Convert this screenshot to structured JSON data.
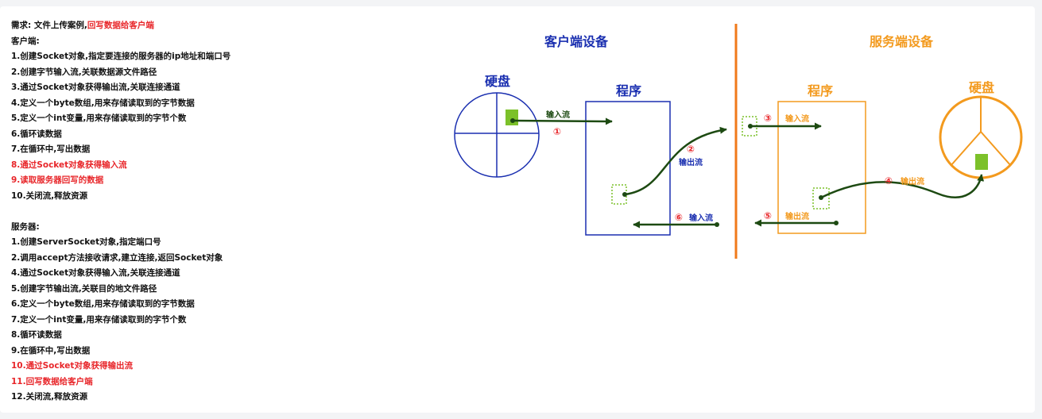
{
  "requirements": {
    "title": "需求: 文件上传案例,",
    "title_highlight": "回写数据给客户端",
    "client_heading": "客户端:",
    "client_steps": [
      {
        "text": "1.创建Socket对象,指定要连接的服务器的ip地址和端口号",
        "highlight": false
      },
      {
        "text": "2.创建字节输入流,关联数据源文件路径",
        "highlight": false
      },
      {
        "text": "3.通过Socket对象获得输出流,关联连接通道",
        "highlight": false
      },
      {
        "text": "4.定义一个byte数组,用来存储读取到的字节数据",
        "highlight": false
      },
      {
        "text": "5.定义一个int变量,用来存储读取到的字节个数",
        "highlight": false
      },
      {
        "text": "6.循环读数据",
        "highlight": false
      },
      {
        "text": "7.在循环中,写出数据",
        "highlight": false
      },
      {
        "text": "8.通过Socket对象获得输入流",
        "highlight": true
      },
      {
        "text": "9.读取服务器回写的数据",
        "highlight": true
      },
      {
        "text": "10.关闭流,释放资源",
        "highlight": false
      }
    ],
    "server_heading": "服务器:",
    "server_steps": [
      {
        "text": "1.创建ServerSocket对象,指定端口号",
        "highlight": false
      },
      {
        "text": "2.调用accept方法接收请求,建立连接,返回Socket对象",
        "highlight": false
      },
      {
        "text": "4.通过Socket对象获得输入流,关联连接通道",
        "highlight": false
      },
      {
        "text": "5.创建字节输出流,关联目的地文件路径",
        "highlight": false
      },
      {
        "text": "6.定义一个byte数组,用来存储读取到的字节数据",
        "highlight": false
      },
      {
        "text": "7.定义一个int变量,用来存储读取到的字节个数",
        "highlight": false
      },
      {
        "text": "8.循环读数据",
        "highlight": false
      },
      {
        "text": "9.在循环中,写出数据",
        "highlight": false
      },
      {
        "text": "10.通过Socket对象获得输出流",
        "highlight": true
      },
      {
        "text": "11.回写数据给客户端",
        "highlight": true
      },
      {
        "text": "12.关闭流,释放资源",
        "highlight": false
      }
    ]
  },
  "diagram": {
    "client_device": "客户端设备",
    "server_device": "服务端设备",
    "client_disk": "硬盘",
    "server_disk": "硬盘",
    "client_program": "程序",
    "server_program": "程序",
    "step1_label": "输入流",
    "step1_num": "①",
    "step2_num": "②",
    "step2_label": "输出流",
    "step3_num": "③",
    "step3_label": "输入流",
    "step4_num": "④",
    "step4_label": "输出流",
    "step5_num": "⑤",
    "step5_label": "输出流",
    "step6_num": "⑥",
    "step6_label": "输入流",
    "colors": {
      "client": "#1a2fb0",
      "server": "#f39a1e",
      "divider": "#f07a1a",
      "arrow": "#1d4a12",
      "number": "#e8262a",
      "file": "#7cc12a"
    }
  }
}
